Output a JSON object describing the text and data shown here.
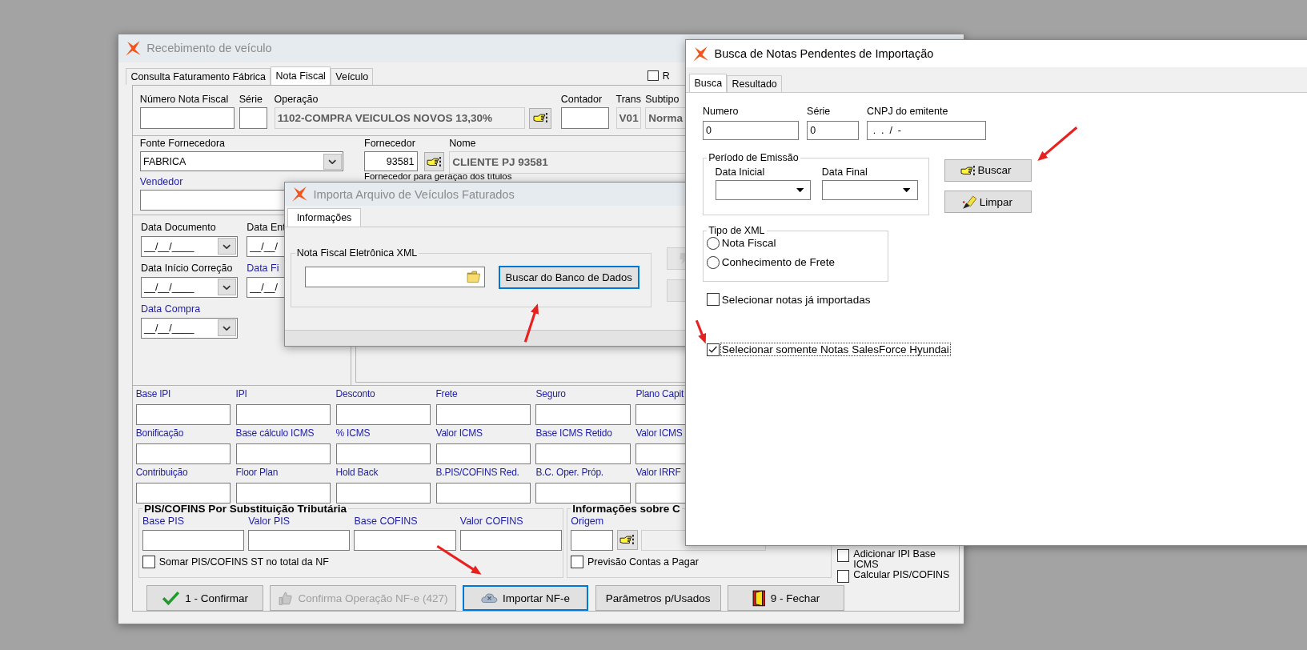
{
  "main_window": {
    "title": "Recebimento de veículo",
    "tabs": [
      {
        "label": "Consulta Faturamento Fábrica",
        "selected": false
      },
      {
        "label": "Nota Fiscal",
        "selected": true
      },
      {
        "label": "Veículo",
        "selected": false
      }
    ],
    "corner_checkbox": {
      "label": "R",
      "checked": false
    },
    "invoice_fields": [
      {
        "label": "Número Nota Fiscal",
        "kind": "input"
      },
      {
        "label": "Série",
        "kind": "input"
      },
      {
        "label": "Operação",
        "kind": "lookup",
        "value": "1102-COMPRA VEICULOS NOVOS 13,30%"
      },
      {
        "label": "Contador",
        "kind": "input"
      },
      {
        "label": "Trans",
        "kind": "readonly",
        "value": "V01"
      },
      {
        "label": "Subtipo",
        "kind": "readonly",
        "value": "Norma"
      }
    ],
    "supplier": {
      "source_label": "Fonte Fornecedora",
      "source_value": "FABRICA",
      "supplier_label": "Fornecedor",
      "supplier_value": "93581",
      "name_label": "Nome",
      "name_value": "CLIENTE PJ 93581",
      "note": "Fornecedor para geração dos títulos",
      "seller_label": "Vendedor"
    },
    "dates": [
      {
        "label": "Data Documento",
        "value": "__/__/____",
        "color": "#000000"
      },
      {
        "label": "Data Ent",
        "value": "__/__/",
        "color": "#000000"
      },
      {
        "label": "Data Início Correção",
        "value": "__/__/____",
        "color": "#000000"
      },
      {
        "label": "Data Fi",
        "value": "__/__/",
        "color": "#1c1ca8"
      },
      {
        "label": "Data Compra",
        "value": "__/__/____",
        "color": "#1c1ca8"
      }
    ],
    "amount_rows": [
      [
        "Base IPI",
        "IPI",
        "Desconto",
        "Frete",
        "Seguro",
        "Plano Capit"
      ],
      [
        "Bonificação",
        "Base cálculo ICMS",
        "% ICMS",
        "Valor ICMS",
        "Base ICMS Retido",
        "Valor ICMS"
      ],
      [
        "Contribuição",
        "Floor Plan",
        "Hold Back",
        "B.PIS/COFINS Red.",
        "B.C. Oper. Próp.",
        "Valor IRRF"
      ]
    ],
    "pis_cofins": {
      "title": "PIS/COFINS Por Substituição Tributária",
      "fields": [
        "Base PIS",
        "Valor PIS",
        "Base COFINS",
        "Valor COFINS"
      ],
      "checkbox": {
        "label": "Somar PIS/COFINS ST no total da NF",
        "checked": false
      }
    },
    "info_group": {
      "title": "Informações sobre C",
      "origin_label": "Origem",
      "checkbox": {
        "label": "Previsão Contas a Pagar",
        "checked": false
      }
    },
    "side_checkboxes": [
      {
        "label": "Adicionar IPI Base ICMS",
        "checked": false
      },
      {
        "label": "Calcular PIS/COFINS",
        "checked": false
      }
    ],
    "buttons": [
      {
        "label": "1 - Confirmar",
        "kind": "confirm",
        "disabled": false,
        "focused": false
      },
      {
        "label": "Confirma Operação NF-e (427)",
        "kind": "approve",
        "disabled": true,
        "focused": false
      },
      {
        "label": "Importar NF-e",
        "kind": "import",
        "disabled": false,
        "focused": true
      },
      {
        "label": "Parâmetros p/Usados",
        "kind": "plain",
        "disabled": false,
        "focused": false
      },
      {
        "label": "9 - Fechar",
        "kind": "exit",
        "disabled": false,
        "focused": false
      }
    ]
  },
  "import_dialog": {
    "title": "Importa Arquivo de Veículos Faturados",
    "tabs": [
      {
        "label": "Informações",
        "selected": true
      }
    ],
    "group_title": "Nota Fiscal Eletrônica XML",
    "search_button": "Buscar do Banco de Dados"
  },
  "search_window": {
    "title": "Busca de Notas Pendentes de Importação",
    "tabs": [
      {
        "label": "Busca",
        "selected": true
      },
      {
        "label": "Resultado",
        "selected": false
      }
    ],
    "fields": [
      {
        "label": "Numero",
        "value": "0"
      },
      {
        "label": "Série",
        "value": "0"
      },
      {
        "label": "CNPJ do emitente",
        "value": " .  .  /  -"
      }
    ],
    "period": {
      "title": "Período de Emissão",
      "fields": [
        "Data Inicial",
        "Data Final"
      ]
    },
    "actions": [
      {
        "label": "Buscar",
        "kind": "search"
      },
      {
        "label": "Limpar",
        "kind": "clear"
      }
    ],
    "xml_type": {
      "title": "Tipo de XML",
      "options": [
        {
          "label": "Nota Fiscal",
          "selected": false
        },
        {
          "label": "Conhecimento de Frete",
          "selected": false
        }
      ]
    },
    "checkboxes": [
      {
        "label": "Selecionar notas já importadas",
        "checked": false,
        "focused": false
      },
      {
        "label": "Selecionar somente Notas SalesForce Hyundai",
        "checked": true,
        "focused": true
      }
    ]
  }
}
